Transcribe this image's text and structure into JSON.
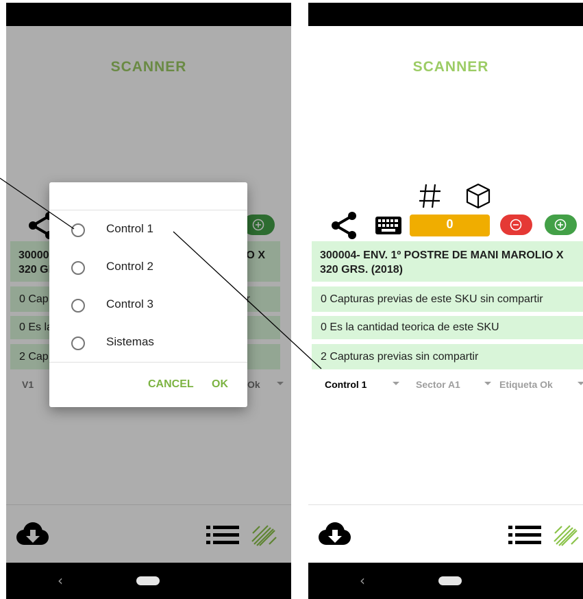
{
  "app": {
    "title": "SCANNER",
    "counter": "0",
    "product": "300004- ENV. 1º POSTRE DE MANI MAROLIO X 320 GRS. (2018)",
    "rows": [
      "0 Capturas previas de este SKU sin compartir",
      "0 Es la cantidad teorica de este SKU",
      "2 Capturas previas sin compartir"
    ],
    "spinners": {
      "control": "Control 1",
      "control_left": "V1",
      "sector": "Sector A1",
      "etiqueta": "Etiqueta Ok",
      "etiqueta_left": "Ok"
    }
  },
  "left_fragments": {
    "product_line1": "30000",
    "product_line1_end": "IO X",
    "product_line2": "320 GI",
    "r1": "0 Cap",
    "r1_end": "tir",
    "r2": "0 Es la",
    "r3": "2 Cap"
  },
  "dialog": {
    "options": [
      "Control 1",
      "Control 2",
      "Control 3",
      "Sistemas"
    ],
    "cancel": "CANCEL",
    "ok": "OK"
  },
  "icons": [
    "hash-icon",
    "cube-icon",
    "share-icon",
    "keyboard-icon",
    "minus-circle-icon",
    "plus-circle-icon",
    "cloud-download-icon",
    "list-icon",
    "barcode-scan-icon",
    "back-icon",
    "home-icon"
  ],
  "colors": {
    "accent_green": "#9ccc65",
    "counter_orange": "#f0ad00",
    "minus_red": "#e53935",
    "plus_green": "#43a047",
    "card_green": "#d9f5d9",
    "dialog_button": "#7cb342"
  }
}
